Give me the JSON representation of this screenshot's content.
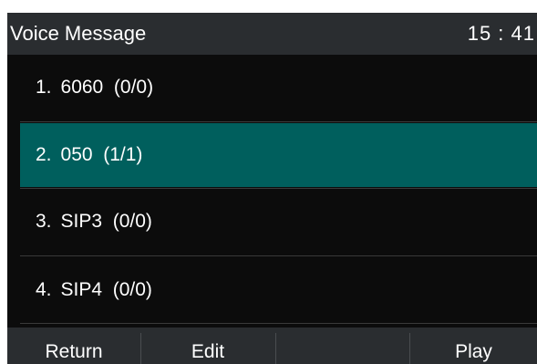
{
  "header": {
    "title": "Voice Message",
    "time": "15 : 41"
  },
  "accounts": [
    {
      "index": "1.",
      "label": "6060  (0/0)",
      "selected": false
    },
    {
      "index": "2.",
      "label": "050  (1/1)",
      "selected": true
    },
    {
      "index": "3.",
      "label": "SIP3  (0/0)",
      "selected": false
    },
    {
      "index": "4.",
      "label": "SIP4  (0/0)",
      "selected": false
    }
  ],
  "softkeys": {
    "key1": "Return",
    "key2": "Edit",
    "key3": "",
    "key4": "Play"
  },
  "colors": {
    "screen_background": "#0c0c0c",
    "bar_background": "#2a2d30",
    "selected_row": "#005f5d",
    "text": "#ffffff"
  }
}
